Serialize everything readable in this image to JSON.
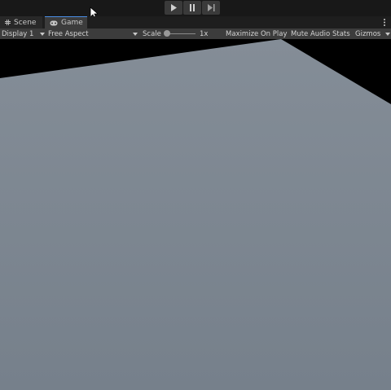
{
  "toolbar": {
    "play_icon": "play-icon",
    "pause_icon": "pause-icon",
    "step_icon": "step-icon"
  },
  "tabs": [
    {
      "label": "Scene",
      "icon": "grid-icon"
    },
    {
      "label": "Game",
      "icon": "gamepad-icon"
    }
  ],
  "game_controls": {
    "display": "Display 1",
    "aspect": "Free Aspect",
    "scale_label": "Scale",
    "scale_value": "1x",
    "maximize_on_play": "Maximize On Play",
    "mute_audio": "Mute Audio",
    "stats": "Stats",
    "gizmos": "Gizmos"
  },
  "colors": {
    "accent": "#4a8ee6",
    "plane": "#7b8590",
    "background": "#000000"
  }
}
